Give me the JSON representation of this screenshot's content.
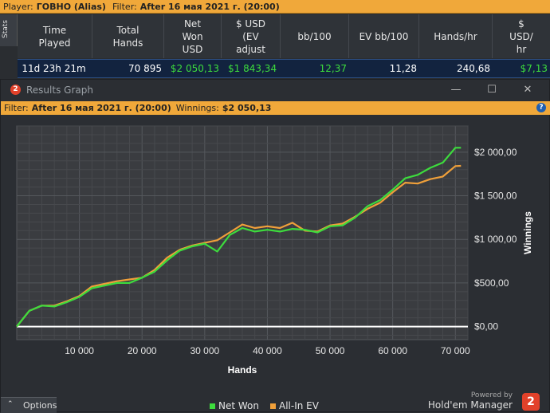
{
  "top_filter": {
    "player_label": "Player:",
    "player_value": "ГОВНО (Alias)",
    "filter_label": "Filter:",
    "filter_value": "After 16 мая 2021 г. (20:00)"
  },
  "stats_tab": {
    "label": "Stats"
  },
  "stats_table": {
    "columns": [
      [
        "Time",
        "Played"
      ],
      [
        "Total",
        "Hands"
      ],
      [
        "Net",
        "Won",
        "USD"
      ],
      [
        "$ USD",
        "(EV",
        "adjust"
      ],
      [
        "bb/100"
      ],
      [
        "EV bb/100"
      ],
      [
        "Hands/hr"
      ],
      [
        "$",
        "USD/",
        "hr"
      ]
    ],
    "row": [
      "11d 23h 21m",
      "70 895",
      "$2 050,13",
      "$1 843,34",
      "12,37",
      "11,28",
      "240,68",
      "$7,13"
    ]
  },
  "window": {
    "title": "Results Graph",
    "app_icon": "2",
    "controls": {
      "minimize": "—",
      "maximize": "☐",
      "close": "✕"
    },
    "filter_label": "Filter:",
    "filter_value": "After 16 мая 2021 г. (20:00)",
    "winnings_label": "Winnings:",
    "winnings_value": "$2 050,13",
    "help_icon": "?"
  },
  "chart_data": {
    "type": "line",
    "xlabel": "Hands",
    "ylabel": "Winnings",
    "xlim": [
      0,
      72000
    ],
    "ylim": [
      -150,
      2300
    ],
    "x_ticks": [
      10000,
      20000,
      30000,
      40000,
      50000,
      60000,
      70000
    ],
    "x_tick_labels": [
      "10 000",
      "20 000",
      "30 000",
      "40 000",
      "50 000",
      "60 000",
      "70 000"
    ],
    "y_ticks": [
      0,
      500,
      1000,
      1500,
      2000
    ],
    "y_tick_labels": [
      "$0,00",
      "$500,00",
      "$1 000,00",
      "$1 500,00",
      "$2 000,00"
    ],
    "grid": true,
    "legend": "bottom-center",
    "series": [
      {
        "name": "Net Won",
        "color": "#3ddc3d",
        "x": [
          0,
          2000,
          4000,
          6000,
          8000,
          10000,
          12000,
          14000,
          16000,
          18000,
          20000,
          22000,
          24000,
          26000,
          28000,
          30000,
          32000,
          34000,
          36000,
          38000,
          40000,
          42000,
          44000,
          46000,
          48000,
          50000,
          52000,
          54000,
          56000,
          58000,
          60000,
          62000,
          64000,
          66000,
          68000,
          70000,
          70895
        ],
        "y": [
          0,
          180,
          240,
          230,
          280,
          340,
          440,
          470,
          500,
          500,
          560,
          630,
          760,
          870,
          920,
          950,
          860,
          1050,
          1130,
          1090,
          1110,
          1090,
          1120,
          1110,
          1080,
          1150,
          1160,
          1250,
          1380,
          1450,
          1570,
          1700,
          1740,
          1820,
          1880,
          2050,
          2050
        ]
      },
      {
        "name": "All-In EV",
        "color": "#f0a03a",
        "x": [
          0,
          2000,
          4000,
          6000,
          8000,
          10000,
          12000,
          14000,
          16000,
          18000,
          20000,
          22000,
          24000,
          26000,
          28000,
          30000,
          32000,
          34000,
          36000,
          38000,
          40000,
          42000,
          44000,
          46000,
          48000,
          50000,
          52000,
          54000,
          56000,
          58000,
          60000,
          62000,
          64000,
          66000,
          68000,
          70000,
          70895
        ],
        "y": [
          0,
          180,
          240,
          240,
          290,
          350,
          460,
          490,
          520,
          540,
          560,
          650,
          790,
          880,
          930,
          960,
          990,
          1080,
          1170,
          1130,
          1150,
          1130,
          1190,
          1100,
          1090,
          1160,
          1180,
          1260,
          1350,
          1420,
          1540,
          1650,
          1640,
          1690,
          1720,
          1840,
          1843
        ]
      }
    ]
  },
  "options_tab": {
    "label": "Options",
    "icon": "⌃"
  },
  "branding": {
    "powered_by": "Powered by",
    "name": "Hold'em Manager",
    "logo": "2"
  }
}
